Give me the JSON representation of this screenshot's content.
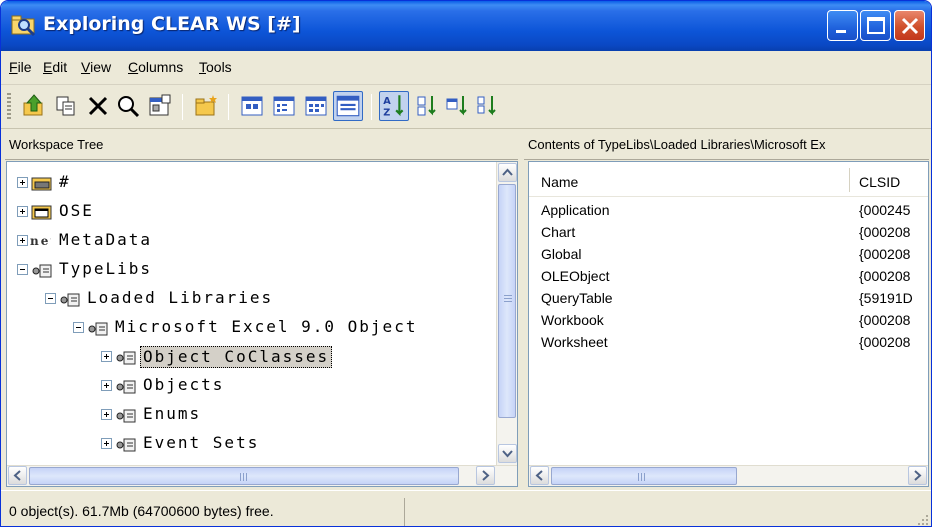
{
  "window": {
    "title": "Exploring CLEAR WS [#]",
    "title_icon": "explorer-magnifier-icon"
  },
  "title_buttons": {
    "minimize": "minimize-icon",
    "maximize": "maximize-icon",
    "close": "close-icon"
  },
  "menu": [
    {
      "label": "File",
      "mnemonic": "F",
      "rest": "ile"
    },
    {
      "label": "Edit",
      "mnemonic": "E",
      "rest": "dit"
    },
    {
      "label": "View",
      "mnemonic": "V",
      "rest": "iew"
    },
    {
      "label": "Columns",
      "mnemonic": "C",
      "rest": "olumns"
    },
    {
      "label": "Tools",
      "mnemonic": "T",
      "rest": "ools"
    }
  ],
  "toolbar": {
    "buttons": [
      "up-folder-icon",
      "copy-icon",
      "delete-icon",
      "find-icon",
      "properties-icon",
      "new-folder-icon",
      "large-icons-view-icon",
      "small-icons-view-icon",
      "list-view-icon",
      "details-view-icon",
      "sort-ascending-icon",
      "sort-by-size-icon",
      "sort-by-type-icon",
      "sort-by-date-icon"
    ],
    "active": [
      "details-view-icon",
      "sort-ascending-icon"
    ]
  },
  "left_pane": {
    "header": "Workspace Tree"
  },
  "tree": [
    {
      "label": "#",
      "icon": "drive-folder-icon",
      "expander": "plus",
      "level": 0
    },
    {
      "label": "OSE",
      "icon": "window-folder-icon",
      "expander": "plus",
      "level": 0
    },
    {
      "label": "MetaData",
      "icon": "dotnet-icon",
      "expander": "plus",
      "level": 0
    },
    {
      "label": "TypeLibs",
      "icon": "typelib-icon",
      "expander": "minus",
      "level": 0
    },
    {
      "label": "Loaded Libraries",
      "icon": "typelib-icon",
      "expander": "minus",
      "level": 1
    },
    {
      "label": "Microsoft Excel 9.0 Object",
      "icon": "typelib-icon",
      "expander": "minus",
      "level": 2
    },
    {
      "label": "Object CoClasses",
      "icon": "typelib-icon",
      "expander": "plus",
      "level": 3,
      "selected": true
    },
    {
      "label": "Objects",
      "icon": "typelib-icon",
      "expander": "plus",
      "level": 3
    },
    {
      "label": "Enums",
      "icon": "typelib-icon",
      "expander": "plus",
      "level": 3
    },
    {
      "label": "Event Sets",
      "icon": "typelib-icon",
      "expander": "plus",
      "level": 3
    }
  ],
  "right_pane": {
    "header": "Contents of TypeLibs\\Loaded Libraries\\Microsoft Ex",
    "columns": [
      "Name",
      "CLSID"
    ],
    "rows": [
      [
        "Application",
        "{000245"
      ],
      [
        "Chart",
        "{000208"
      ],
      [
        "Global",
        "{000208"
      ],
      [
        "OLEObject",
        "{000208"
      ],
      [
        "QueryTable",
        "{59191D"
      ],
      [
        "Workbook",
        "{000208"
      ],
      [
        "Worksheet",
        "{000208"
      ]
    ]
  },
  "status": {
    "text": "0 object(s). 61.7Mb (64700600 bytes) free."
  },
  "colors": {
    "title_blue": "#0a5ee8",
    "selection_gray": "#d4d0c8",
    "chrome": "#ece9d8"
  }
}
